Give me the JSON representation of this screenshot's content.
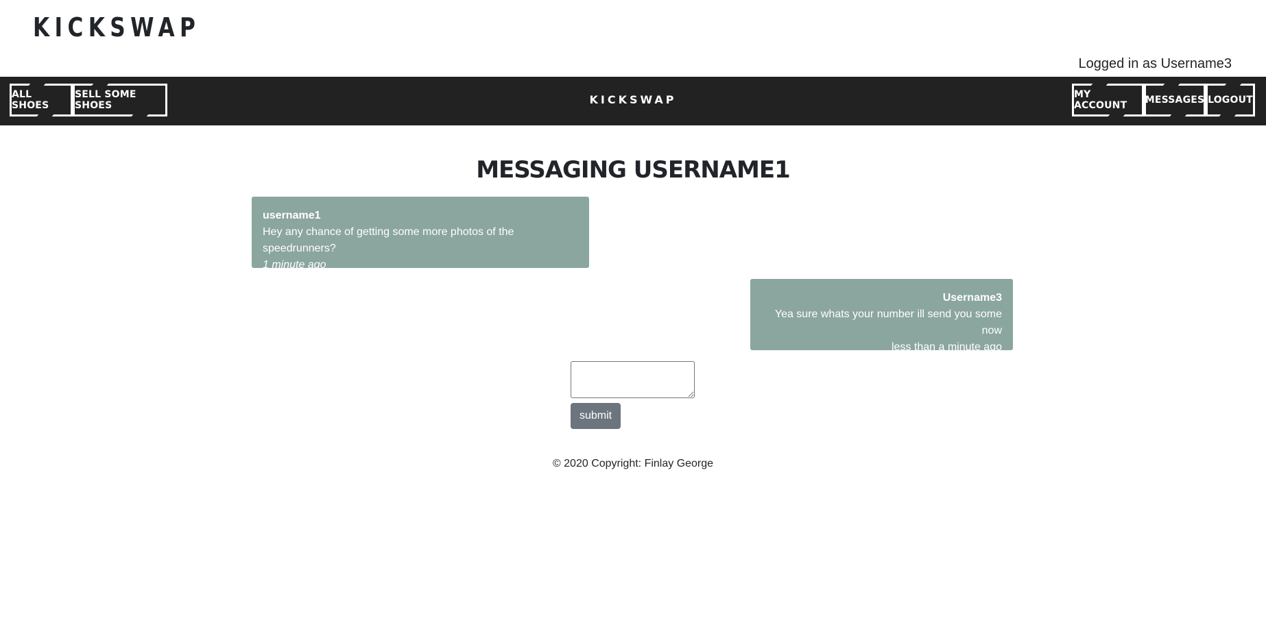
{
  "header": {
    "logo": "KICKSWAP",
    "login_status": "Logged in as Username3"
  },
  "navbar": {
    "left_links": [
      "ALL SHOES",
      "SELL SOME SHOES"
    ],
    "center_brand": "KICKSWAP",
    "right_links": [
      "MY ACCOUNT",
      "MESSAGES",
      "LOGOUT"
    ]
  },
  "page": {
    "title": "MESSAGING USERNAME1"
  },
  "messages": [
    {
      "author": "username1",
      "text": "Hey any chance of getting some more photos of the speedrunners?",
      "time": "1 minute ago",
      "direction": "incoming"
    },
    {
      "author": "Username3",
      "text": "Yea sure whats your number ill send you some now",
      "time": "less than a minute ago",
      "direction": "outgoing"
    }
  ],
  "reply_form": {
    "value": "",
    "submit_label": "submit"
  },
  "footer": {
    "copyright": "© 2020 Copyright: Finlay George"
  },
  "colors": {
    "navbar_bg": "#222222",
    "message_bg": "#8ba59f",
    "submit_bg": "#6c757d",
    "text": "#212529"
  }
}
